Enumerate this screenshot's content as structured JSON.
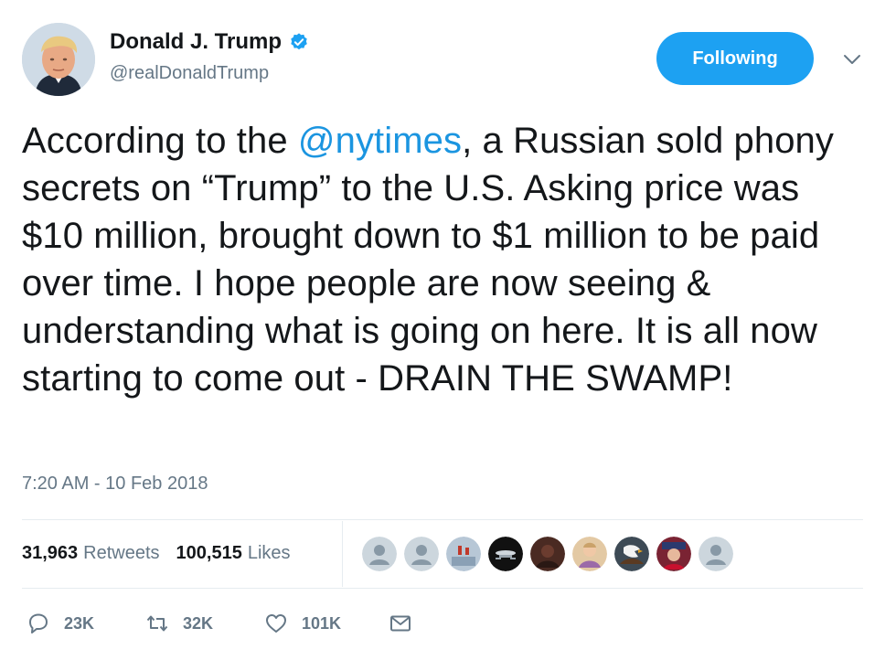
{
  "author": {
    "display_name": "Donald J. Trump",
    "handle": "@realDonaldTrump",
    "verified": true,
    "avatar_icon": "profile-photo"
  },
  "follow_button": {
    "label": "Following",
    "color": "#1da1f2"
  },
  "menu": {
    "icon": "chevron-down-icon"
  },
  "tweet": {
    "text_before_mention": "According to the ",
    "mention": "@nytimes",
    "text_after_mention": ", a Russian sold phony secrets on “Trump” to the U.S. Asking price was $10 million, brought down to $1 million to be paid over time. I hope people are now seeing & understanding what is going on here. It is all now starting to come out - DRAIN THE SWAMP!",
    "timestamp": "7:20 AM - 10 Feb 2018",
    "mention_color": "#1b95e0"
  },
  "stats": {
    "retweets": {
      "value": "31,963",
      "label": "Retweets"
    },
    "likes": {
      "value": "100,515",
      "label": "Likes"
    }
  },
  "likers": [
    {
      "icon": "default-avatar",
      "color": "#aab8c2"
    },
    {
      "icon": "default-avatar",
      "color": "#aab8c2"
    },
    {
      "icon": "photo-avatar",
      "color": "#b7c7d6"
    },
    {
      "icon": "starship-avatar",
      "color": "#111111"
    },
    {
      "icon": "photo-avatar",
      "color": "#4a2a22"
    },
    {
      "icon": "photo-avatar",
      "color": "#d8b48a"
    },
    {
      "icon": "eagle-avatar",
      "color": "#3d4a55"
    },
    {
      "icon": "photo-avatar",
      "color": "#7a2333"
    },
    {
      "icon": "default-avatar",
      "color": "#aab8c2"
    }
  ],
  "actions": {
    "reply": {
      "icon": "reply-icon",
      "count": "23K"
    },
    "retweet": {
      "icon": "retweet-icon",
      "count": "32K"
    },
    "like": {
      "icon": "heart-icon",
      "count": "101K"
    },
    "message": {
      "icon": "envelope-icon"
    }
  }
}
